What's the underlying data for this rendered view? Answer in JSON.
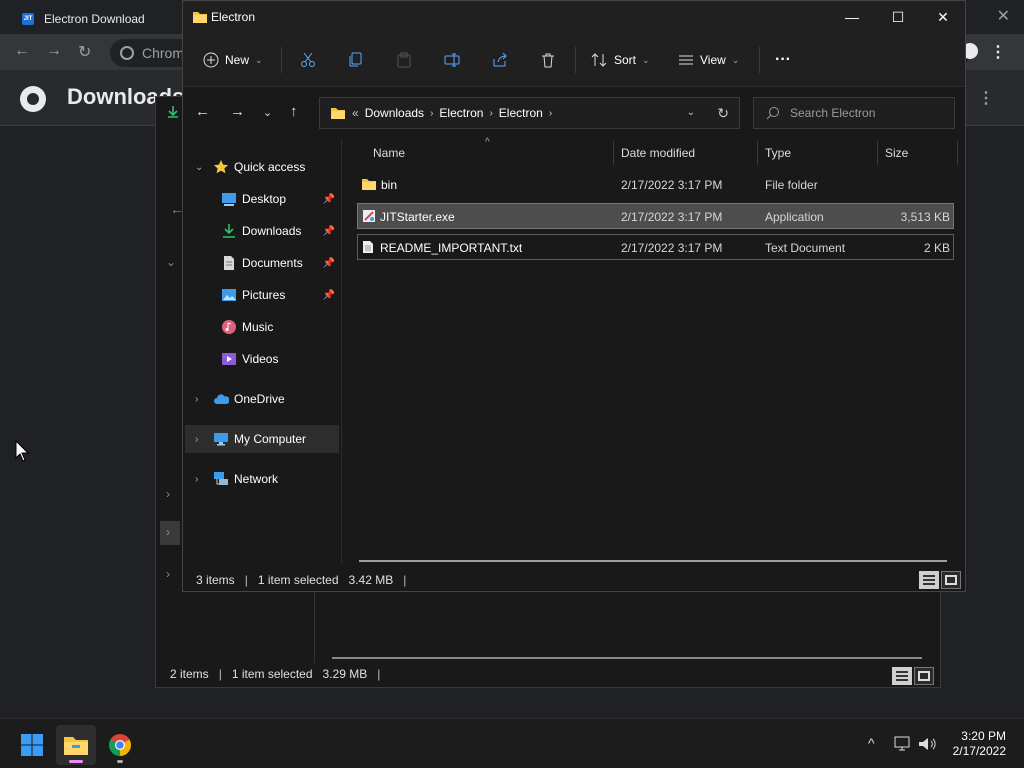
{
  "chrome": {
    "tab_title": "Electron Download",
    "tab_favicon_text": "JIT",
    "omnibox_text": "Chrom",
    "page_title": "Downloads",
    "close_glyph": "✕"
  },
  "bg_explorer": {
    "status": {
      "items": "2 items",
      "selected": "1 item selected",
      "size": "3.29 MB"
    }
  },
  "explorer": {
    "window_title": "Electron",
    "controls": {
      "minimize": "—",
      "maximize": "☐",
      "close": "✕"
    },
    "ribbon": {
      "new_label": "New",
      "sort_label": "Sort",
      "view_label": "View",
      "more_label": "···",
      "icons": [
        "cut-icon",
        "copy-icon",
        "paste-icon",
        "rename-icon",
        "share-icon",
        "delete-icon"
      ]
    },
    "address": {
      "overflow": "«",
      "crumbs": [
        "Downloads",
        "Electron",
        "Electron"
      ],
      "search_placeholder": "Search Electron"
    },
    "nav": [
      {
        "label": "Quick access",
        "icon": "star-icon",
        "expandable": true,
        "expanded": true,
        "indent": 0,
        "pinned": false
      },
      {
        "label": "Desktop",
        "icon": "desktop-icon",
        "indent": 1,
        "pinned": true
      },
      {
        "label": "Downloads",
        "icon": "download-icon",
        "indent": 1,
        "pinned": true
      },
      {
        "label": "Documents",
        "icon": "documents-icon",
        "indent": 1,
        "pinned": true
      },
      {
        "label": "Pictures",
        "icon": "pictures-icon",
        "indent": 1,
        "pinned": true
      },
      {
        "label": "Music",
        "icon": "music-icon",
        "indent": 1,
        "pinned": false
      },
      {
        "label": "Videos",
        "icon": "videos-icon",
        "indent": 1,
        "pinned": false
      },
      {
        "label": "OneDrive",
        "icon": "cloud-icon",
        "expandable": true,
        "indent": 0,
        "pinned": false
      },
      {
        "label": "My Computer",
        "icon": "computer-icon",
        "expandable": true,
        "indent": 0,
        "pinned": false,
        "selected": true
      },
      {
        "label": "Network",
        "icon": "network-icon",
        "expandable": true,
        "indent": 0,
        "pinned": false
      }
    ],
    "columns": [
      "Name",
      "Date modified",
      "Type",
      "Size"
    ],
    "files": [
      {
        "name": "bin",
        "date": "2/17/2022 3:17 PM",
        "type": "File folder",
        "size": "",
        "icon": "folder-icon",
        "state": ""
      },
      {
        "name": "JITStarter.exe",
        "date": "2/17/2022 3:17 PM",
        "type": "Application",
        "size": "3,513 KB",
        "icon": "app-icon",
        "state": "sel"
      },
      {
        "name": "README_IMPORTANT.txt",
        "date": "2/17/2022 3:17 PM",
        "type": "Text Document",
        "size": "2 KB",
        "icon": "text-file-icon",
        "state": "focus"
      }
    ],
    "status": {
      "items": "3 items",
      "selected": "1 item selected",
      "size": "3.42 MB"
    }
  },
  "taskbar": {
    "apps": [
      "start-icon",
      "file-explorer-icon",
      "chrome-icon"
    ],
    "time": "3:20 PM",
    "date": "2/17/2022"
  },
  "colors": {
    "accent_folder": "#f4c542",
    "selection": "#4d4d4d",
    "start_blue": "#3b9cf5",
    "indicator": "#e58ff0"
  }
}
